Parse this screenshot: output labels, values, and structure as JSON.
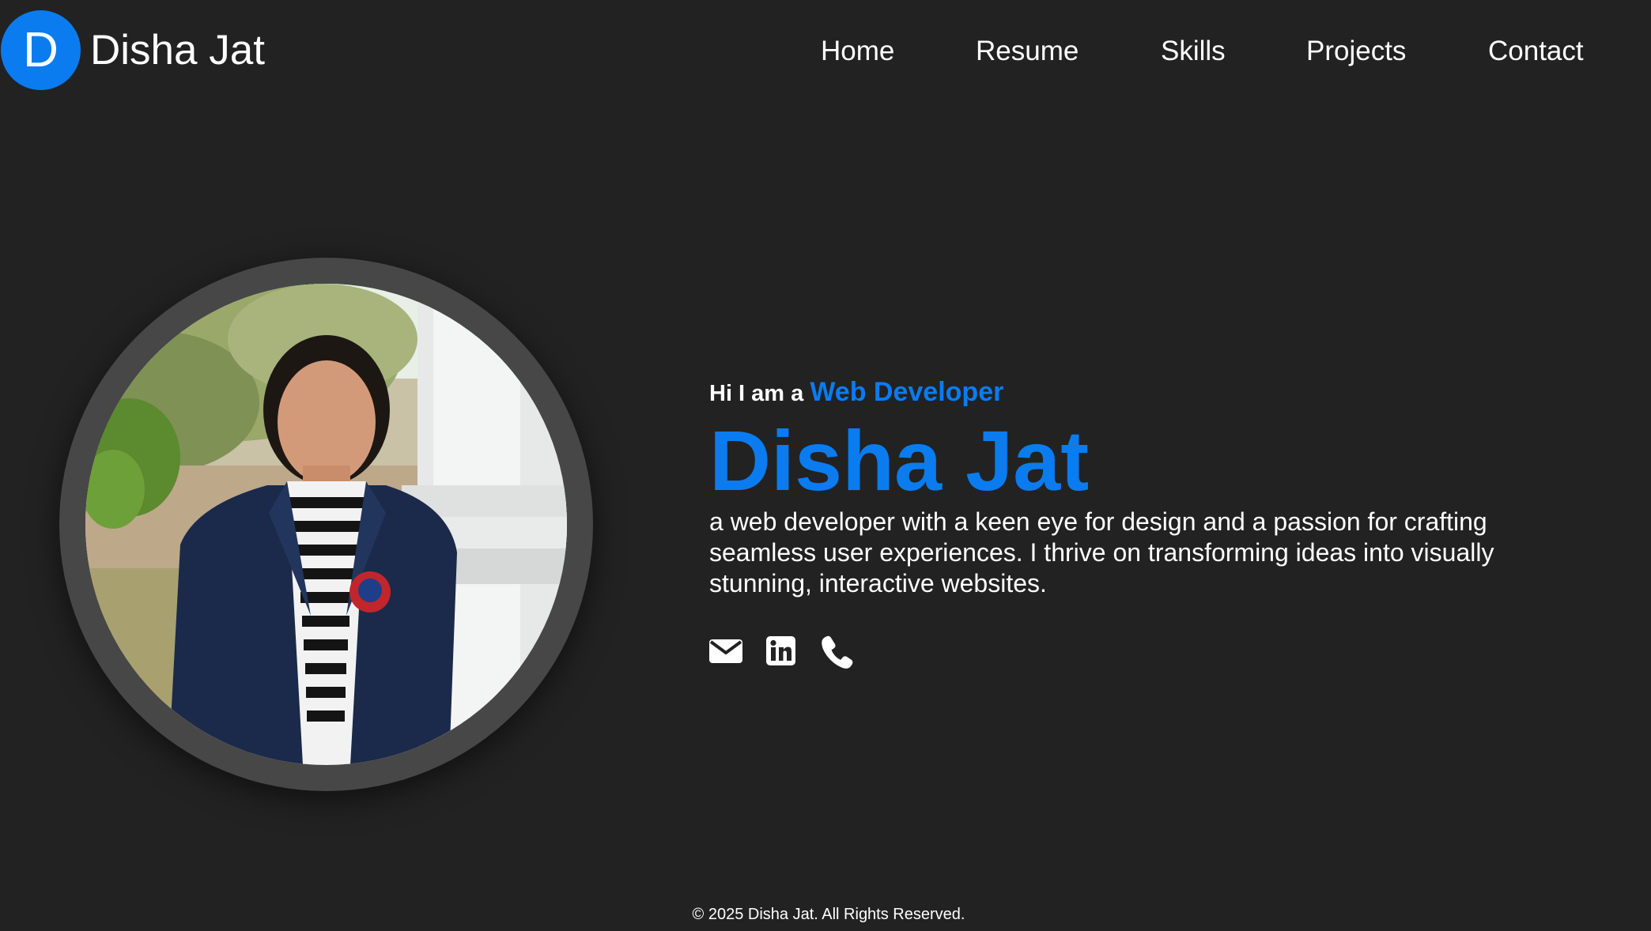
{
  "brand": {
    "logo_letter": "D",
    "name": "Disha Jat",
    "accent_color": "#0a7cf0",
    "background_color": "#222222"
  },
  "nav": {
    "items": [
      {
        "label": "Home"
      },
      {
        "label": "Resume"
      },
      {
        "label": "Skills"
      },
      {
        "label": "Projects"
      },
      {
        "label": "Contact"
      }
    ]
  },
  "hero": {
    "intro_prefix": "Hi I am a ",
    "role": "Web Developer",
    "name": "Disha Jat",
    "bio": "a web developer with a keen eye for design and a passion for crafting seamless user experiences. I thrive on transforming ideas into visually stunning, interactive websites.",
    "photo_alt": "profile-photo",
    "social_icons": [
      "envelope-icon",
      "linkedin-icon",
      "phone-icon"
    ]
  },
  "footer": {
    "copyright": "© 2025 Disha Jat. All Rights Reserved."
  }
}
